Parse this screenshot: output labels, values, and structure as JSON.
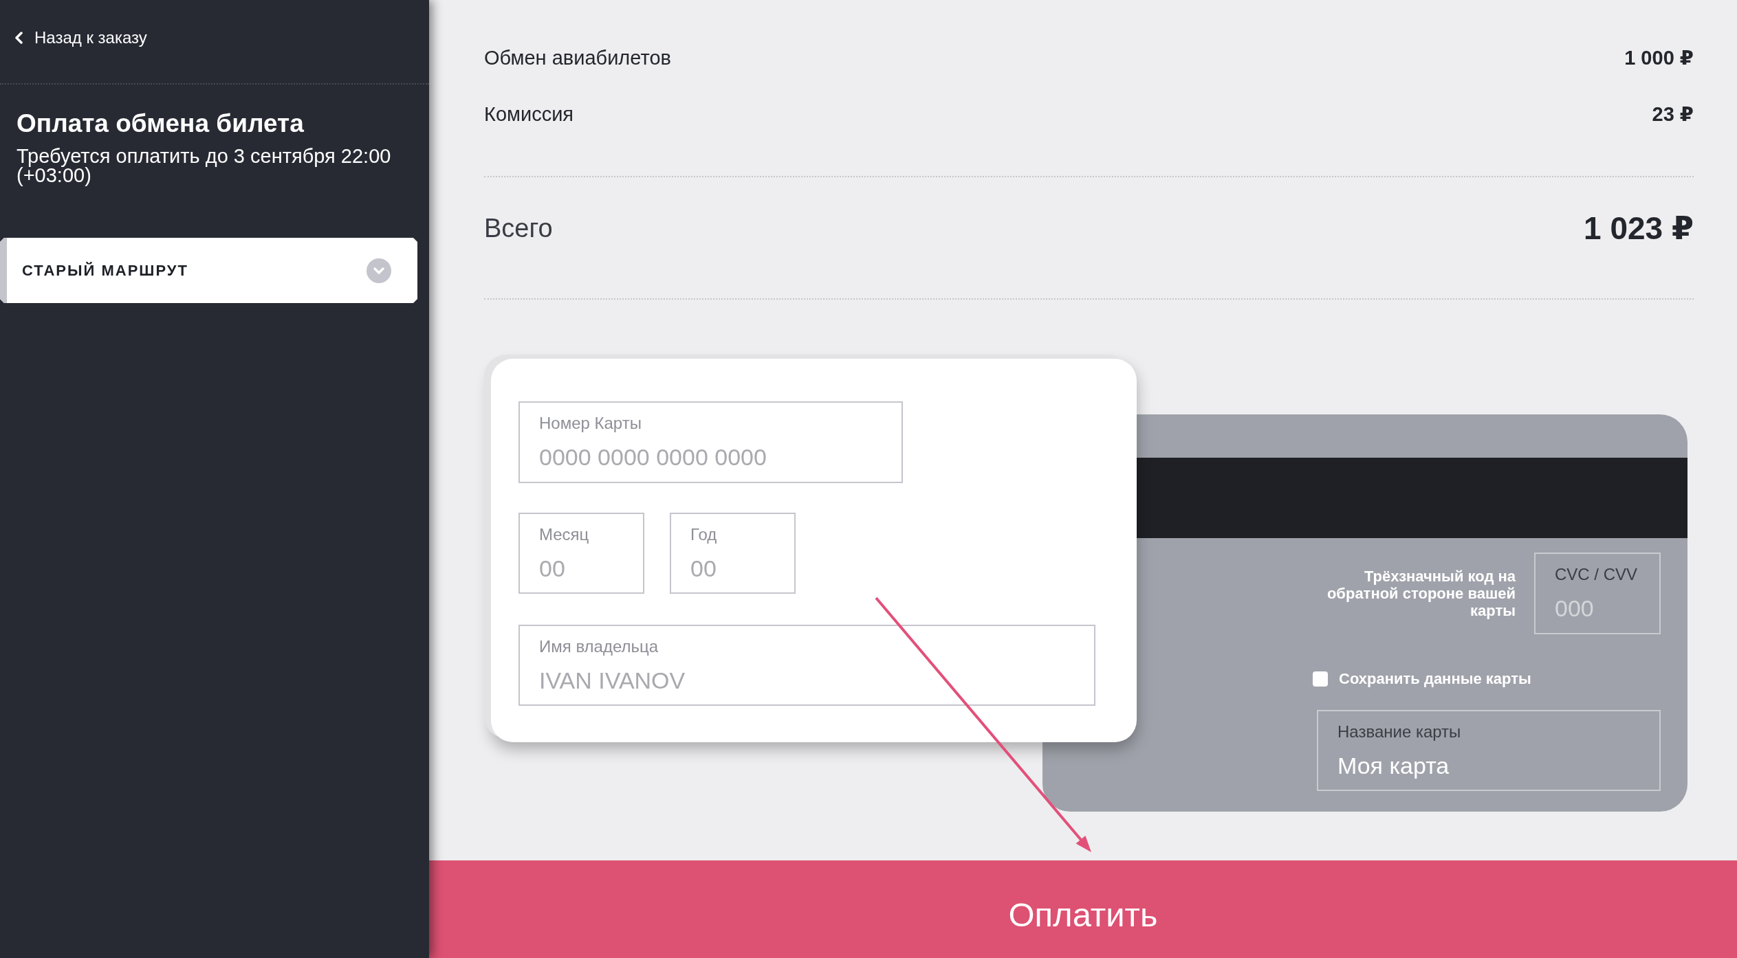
{
  "sidebar": {
    "back_link": "Назад к заказу",
    "title": "Оплата обмена билета",
    "subtitle": "Требуется оплатить до 3 сентября 22:00 (+03:00)",
    "sections": [
      {
        "label": "СТАРЫЙ МАРШРУТ",
        "expanded": false
      }
    ]
  },
  "summary": {
    "items": [
      {
        "label": "Обмен авиабилетов",
        "amount": "1 000 ₽"
      },
      {
        "label": "Комиссия",
        "amount": "23 ₽"
      }
    ],
    "total": {
      "label": "Всего",
      "amount": "1 023 ₽"
    }
  },
  "card_front": {
    "fields": [
      {
        "label": "Номер Карты",
        "placeholder": "0000 0000 0000 0000"
      },
      {
        "label": "Месяц",
        "placeholder": "00"
      },
      {
        "label": "Год",
        "placeholder": "00"
      },
      {
        "label": "Имя владельца",
        "placeholder": "IVAN IVANOV"
      }
    ]
  },
  "card_back": {
    "cvc_hint": "Трёхзначный код на обратной стороне вашей карты",
    "cvc_field": {
      "label": "CVC / CVV",
      "placeholder": "000"
    },
    "save_card": {
      "label": "Сохранить данные карты",
      "checked": false
    },
    "card_name_field": {
      "label": "Название карты",
      "value": "Моя карта"
    }
  },
  "pay_button": "Оплатить"
}
